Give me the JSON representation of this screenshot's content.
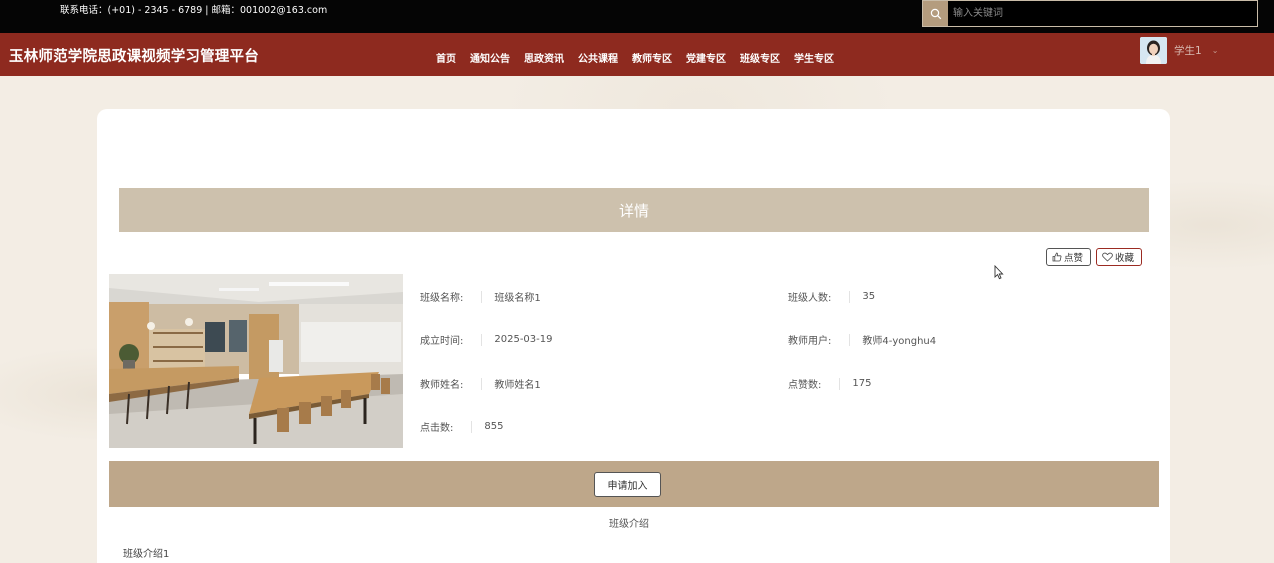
{
  "topbar": {
    "contact": "联系电话：(+01) - 2345 - 6789 | 邮箱：001002@163.com",
    "search_placeholder": "输入关键词",
    "search_icon": "search-icon"
  },
  "header": {
    "site_title": "玉林师范学院思政课视频学习管理平台",
    "nav": [
      "首页",
      "通知公告",
      "思政资讯",
      "公共课程",
      "教师专区",
      "党建专区",
      "班级专区",
      "学生专区"
    ],
    "user_name": "学生1",
    "user_caret": "⌄"
  },
  "detail": {
    "title": "详情",
    "like_label": "点赞",
    "favorite_label": "收藏",
    "fields": {
      "class_name_label": "班级名称:",
      "class_name": "班级名称1",
      "class_size_label": "班级人数:",
      "class_size": "35",
      "created_label": "成立时间:",
      "created": "2025-03-19",
      "teacher_user_label": "教师用户:",
      "teacher_user": "教师4-yonghu4",
      "teacher_name_label": "教师姓名:",
      "teacher_name": "教师姓名1",
      "likes_label": "点赞数:",
      "likes": "175",
      "clicks_label": "点击数:",
      "clicks": "855"
    },
    "join_button": "申请加入",
    "intro_heading": "班级介绍",
    "intro_text": "班级介绍1"
  },
  "colors": {
    "topbar": "#050505",
    "header": "#8e2a1f",
    "banner": "#cdc1ad",
    "join_bar": "#bea78a",
    "page_bg": "#f3ede4"
  }
}
